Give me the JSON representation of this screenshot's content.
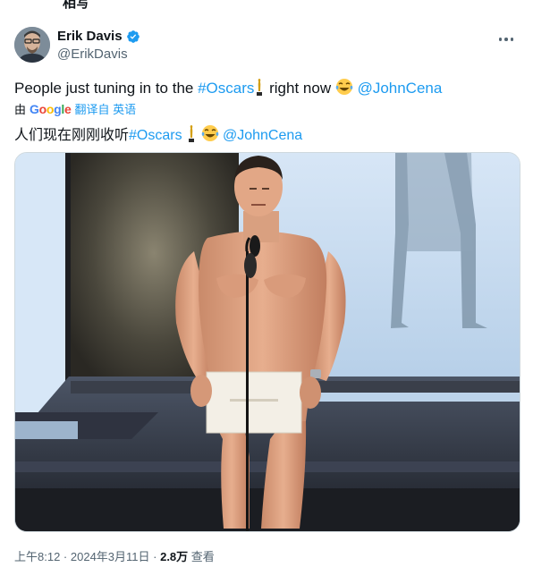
{
  "tweet": {
    "top_cut_text": "相写",
    "author_name": "Erik Davis",
    "author_handle": "@ErikDavis",
    "text_before": "People just tuning in to the ",
    "hashtag": "#Oscars",
    "text_middle": " right now ",
    "mention": "@JohnCena",
    "translate_prefix": "由",
    "translate_provider": "Google",
    "translate_label": "翻译自 英语",
    "translated_before": "人们现在刚刚收听",
    "translated_hashtag": "#Oscars",
    "translated_mention": "@JohnCena",
    "time": "上午8:12",
    "sep1": " · ",
    "date": "2024年3月11日",
    "sep2": " · ",
    "views": "2.8万",
    "views_label": " 查看"
  },
  "icons": {
    "verified": "verified-badge-icon",
    "more": "more-options-icon",
    "oscar": "oscar-statuette-icon",
    "laugh": "tears-of-joy-emoji-icon"
  },
  "colors": {
    "link": "#1d9bf0",
    "text": "#0f1419",
    "muted": "#536471"
  }
}
